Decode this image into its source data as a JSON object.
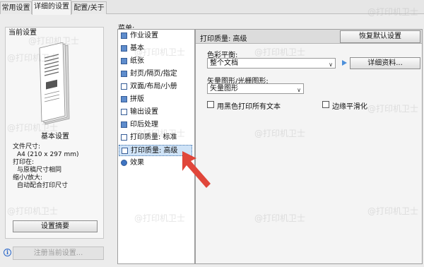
{
  "tabs": [
    {
      "label": "常用设置",
      "active": false
    },
    {
      "label": "详细的设置",
      "active": true
    },
    {
      "label": "配置/关于",
      "active": false
    }
  ],
  "left_panel": {
    "title": "当前设置",
    "preview_label": "基本设置",
    "file_size_label": "文件尺寸:",
    "file_size_value": "A4 (210 x 297 mm)",
    "print_on_label": "打印在:",
    "print_on_value": "与原稿尺寸相同",
    "scale_label": "缩小/放大:",
    "scale_value": "自动配合打印尺寸",
    "summary_button": "设置摘要",
    "register_button": "注册当前设置..."
  },
  "menu": {
    "title": "菜单:",
    "items": [
      {
        "label": "作业设置",
        "icon": "job-settings-icon"
      },
      {
        "label": "基本",
        "icon": "basic-icon"
      },
      {
        "label": "纸张",
        "icon": "paper-icon"
      },
      {
        "label": "封页/隔页/指定",
        "icon": "cover-page-icon"
      },
      {
        "label": "双面/布局/小册",
        "icon": "duplex-layout-icon"
      },
      {
        "label": "拼版",
        "icon": "imposition-icon"
      },
      {
        "label": "输出设置",
        "icon": "output-settings-icon"
      },
      {
        "label": "印后处理",
        "icon": "finishing-icon"
      },
      {
        "label": "打印质量: 标准",
        "icon": "print-quality-standard-icon"
      },
      {
        "label": "打印质量: 高级",
        "icon": "print-quality-advanced-icon",
        "selected": true
      },
      {
        "label": "效果",
        "icon": "effects-icon"
      }
    ]
  },
  "content": {
    "panel_title": "打印质量: 高级",
    "restore_defaults_button": "恢复默认设置",
    "color_balance_label": "色彩平衡:",
    "color_balance_value": "整个文档",
    "details_button": "详细资料...",
    "vector_label": "矢量图形/光栅图形:",
    "vector_value": "矢量图形",
    "checkbox_black": "用黑色打印所有文本",
    "checkbox_smooth": "边缘平滑化"
  },
  "watermark": "@打印机卫士",
  "colors": {
    "selected_bg": "#cfe3f7",
    "arrow": "#e0463a",
    "play_icon": "#4b8fda"
  }
}
